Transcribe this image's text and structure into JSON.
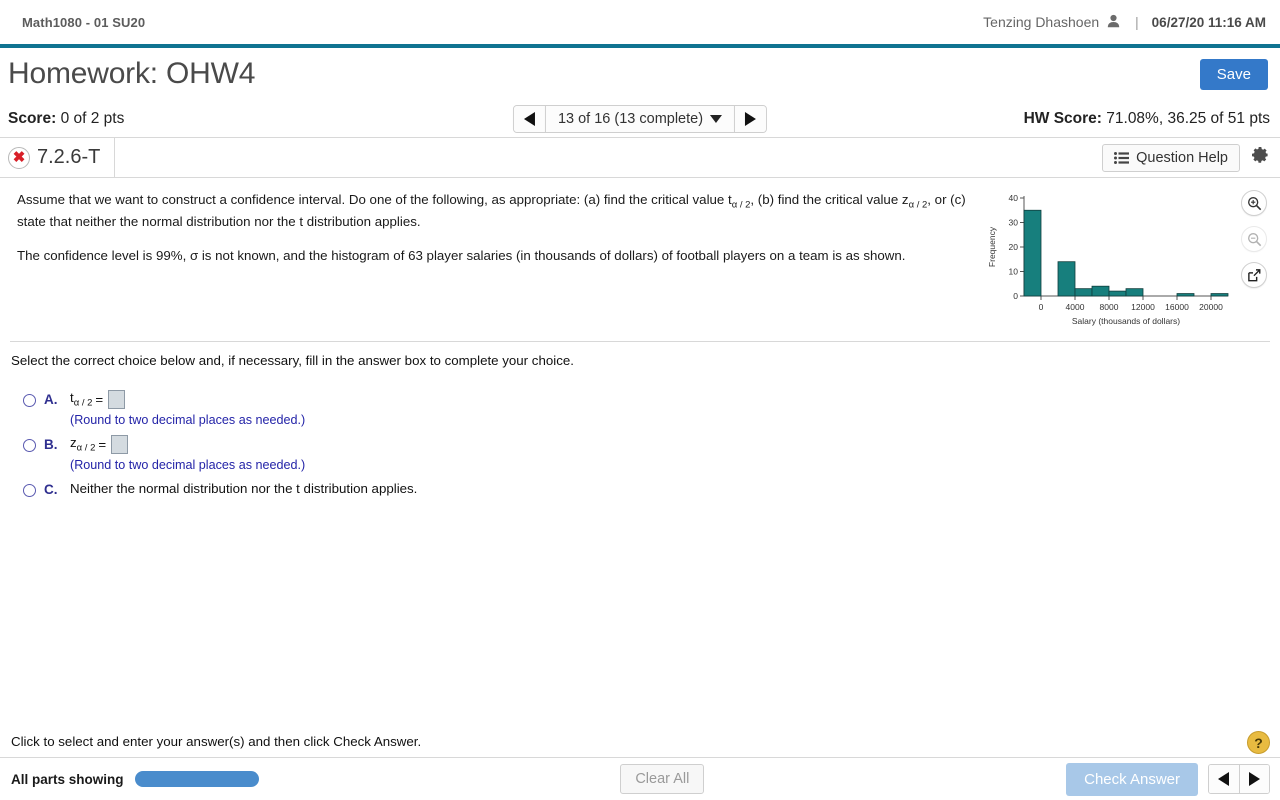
{
  "topbar": {
    "course": "Math1080 - 01 SU20",
    "user_name": "Tenzing Dhashoen",
    "user_icon": "user-icon",
    "separator": "|",
    "datetime": "06/27/20 11:16 AM"
  },
  "header": {
    "title": "Homework: OHW4",
    "save_label": "Save"
  },
  "score_bar": {
    "score_label": "Score:",
    "score_value": "0 of 2 pts",
    "pager_label": "13 of 16 (13 complete)",
    "prev_icon": "triangle-left-icon",
    "next_icon": "triangle-right-icon",
    "dropdown_icon": "caret-down-icon",
    "hw_score_label": "HW Score:",
    "hw_score_value": "71.08%, 36.25 of 51 pts"
  },
  "question_header": {
    "status_icon": "error-x-icon",
    "question_id": "7.2.6-T",
    "question_help_label": "Question Help",
    "list_icon": "list-icon",
    "gear_icon": "gear-icon"
  },
  "problem": {
    "paragraph1_a": "Assume that we want to construct a confidence interval. Do one of the following, as appropriate: (a) find the critical value t",
    "paragraph1_sub1": "α / 2",
    "paragraph1_b": ", (b) find the critical value z",
    "paragraph1_sub2": "α / 2",
    "paragraph1_c": ", or (c) state that neither the normal distribution nor the t distribution applies.",
    "paragraph2": "The confidence level is 99%, σ is not known, and the histogram of 63 player salaries (in thousands of dollars) of football players on a team is as shown.",
    "tools": {
      "zoom_in_icon": "zoom-in-icon",
      "zoom_out_icon": "zoom-out-icon",
      "popout_icon": "popout-icon"
    }
  },
  "chart_data": {
    "type": "bar",
    "title": "",
    "xlabel": "Salary (thousands of dollars)",
    "ylabel": "Frequency",
    "xlim": [
      -2000,
      22000
    ],
    "ylim": [
      0,
      40
    ],
    "xticks": [
      0,
      4000,
      8000,
      12000,
      16000,
      20000
    ],
    "xtick_labels": [
      "0",
      "4000",
      "8000",
      "12000",
      "16000",
      "20000"
    ],
    "yticks": [
      0,
      10,
      20,
      30,
      40
    ],
    "ytick_labels": [
      "0",
      "10",
      "20",
      "30",
      "40"
    ],
    "bin_width": 2000,
    "bin_starts": [
      -2000,
      2000,
      4000,
      6000,
      8000,
      10000,
      12000,
      14000,
      16000,
      18000,
      20000
    ],
    "values": [
      35,
      14,
      3,
      4,
      2,
      3,
      0,
      0,
      1,
      0,
      1
    ],
    "bar_color": "#177f7d",
    "bar_edge_color": "#103e3d",
    "grid": false,
    "legend": false
  },
  "answer": {
    "prompt": "Select the correct choice below and, if necessary, fill in the answer box to complete your choice.",
    "choices": [
      {
        "letter": "A.",
        "type": "input",
        "var": "t",
        "sub": "α / 2",
        "equals": "=",
        "value": "",
        "note": "(Round to two decimal places as needed.)"
      },
      {
        "letter": "B.",
        "type": "input",
        "var": "z",
        "sub": "α / 2",
        "equals": "=",
        "value": "",
        "note": "(Round to two decimal places as needed.)"
      },
      {
        "letter": "C.",
        "type": "text",
        "text": "Neither the normal distribution nor the t distribution applies."
      }
    ]
  },
  "footer": {
    "hint": "Click to select and enter your answer(s) and then click Check Answer.",
    "help_icon": "question-mark-icon",
    "parts_label": "All parts showing",
    "clear_label": "Clear All",
    "check_label": "Check Answer",
    "prev_icon": "triangle-left-icon",
    "next_icon": "triangle-right-icon"
  }
}
